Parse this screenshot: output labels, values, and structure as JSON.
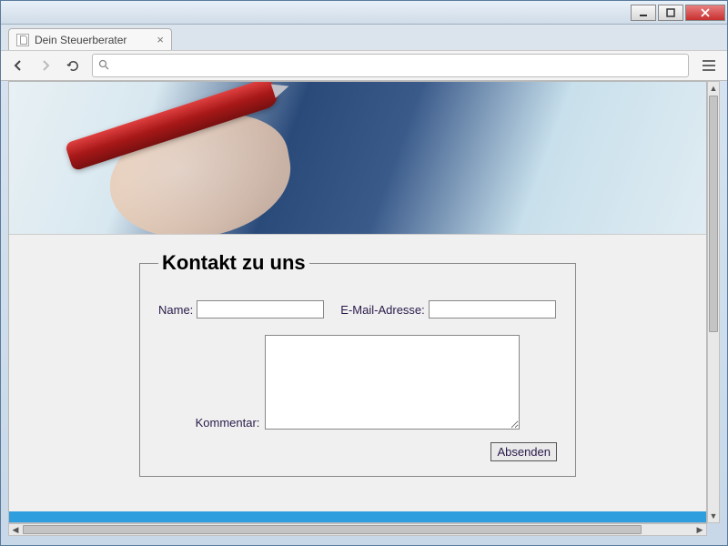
{
  "browser": {
    "tab_title": "Dein Steuerberater",
    "url": ""
  },
  "form": {
    "legend": "Kontakt zu uns",
    "name_label": "Name:",
    "name_value": "",
    "email_label": "E-Mail-Adresse:",
    "email_value": "",
    "comment_label": "Kommentar:",
    "comment_value": "",
    "submit_label": "Absenden"
  }
}
